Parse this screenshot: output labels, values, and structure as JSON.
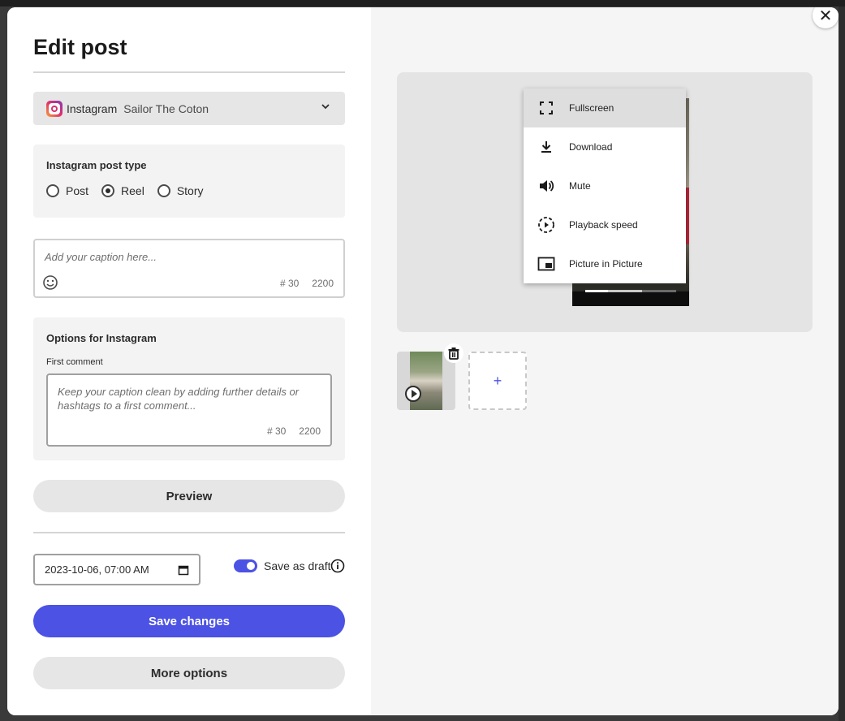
{
  "window": {
    "close_symbol": "✕"
  },
  "editor": {
    "title": "Edit post",
    "account": {
      "network": "Instagram",
      "name": "Sailor The Coton"
    },
    "post_type": {
      "title": "Instagram post type",
      "options": [
        "Post",
        "Reel",
        "Story"
      ],
      "selected": "Reel"
    },
    "caption": {
      "placeholder": "Add your caption here...",
      "hashtag_counter": "# 30",
      "char_counter": "2200"
    },
    "options": {
      "title": "Options for Instagram",
      "first_comment_label": "First comment",
      "first_comment_placeholder": "Keep your caption clean by adding further details or hashtags to a first comment...",
      "hashtag_counter": "# 30",
      "char_counter": "2200"
    },
    "preview_button": "Preview",
    "schedule": {
      "datetime": "2023-10-06, 07:00 AM"
    },
    "draft_toggle": {
      "label": "Save as draft",
      "on": true
    },
    "save_button": "Save changes",
    "more_button": "More options"
  },
  "media": {
    "video_menu": [
      {
        "label": "Fullscreen",
        "icon": "fullscreen-icon"
      },
      {
        "label": "Download",
        "icon": "download-icon"
      },
      {
        "label": "Mute",
        "icon": "volume-icon"
      },
      {
        "label": "Playback speed",
        "icon": "playback-speed-icon"
      },
      {
        "label": "Picture in Picture",
        "icon": "picture-in-picture-icon"
      }
    ],
    "video_progress": 0.25,
    "add_symbol": "+"
  },
  "colors": {
    "accent": "#4b52e4",
    "panel": "#f3f3f3"
  }
}
